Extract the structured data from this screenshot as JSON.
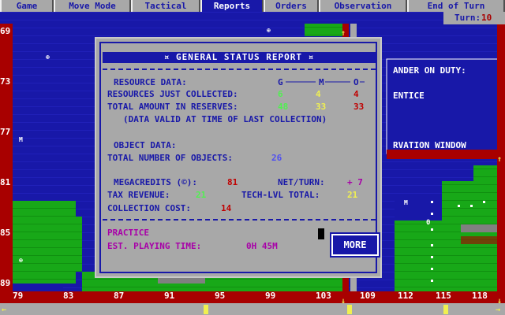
{
  "menu": {
    "items": [
      {
        "label": "Game"
      },
      {
        "label": "Move Mode"
      },
      {
        "label": "Tactical"
      },
      {
        "label": "Reports"
      },
      {
        "label": "Orders"
      },
      {
        "label": "Observation"
      },
      {
        "label": "End of Turn"
      }
    ],
    "active_index": 3
  },
  "turn": {
    "label": "Turn:",
    "value": "10"
  },
  "map": {
    "row_labels": [
      "69",
      "73",
      "77",
      "81",
      "85",
      "89"
    ],
    "col_labels": [
      "79",
      "83",
      "87",
      "91",
      "95",
      "99",
      "103",
      "109",
      "112",
      "115",
      "118"
    ],
    "behind_text_1": "ANDER ON DUTY:",
    "behind_text_2": "ENTICE",
    "behind_text_3": "RVATION WINDOW"
  },
  "report": {
    "title": "¤ GENERAL STATUS REPORT ¤",
    "resource_header": "RESOURCE DATA:",
    "col_g": "G",
    "col_m": "M",
    "col_o": "O",
    "collected_label": "RESOURCES JUST COLLECTED:",
    "collected": {
      "g": "6",
      "m": "4",
      "o": "4"
    },
    "reserves_label": "TOTAL AMOUNT IN RESERVES:",
    "reserves": {
      "g": "48",
      "m": "33",
      "o": "33"
    },
    "validity_note": "(DATA VALID AT TIME OF LAST COLLECTION)",
    "object_header": "OBJECT DATA:",
    "objects_label": "TOTAL NUMBER OF OBJECTS:",
    "objects_value": "26",
    "megacredits_label": "MEGACREDITS (©):",
    "megacredits_value": "81",
    "netturn_label": "NET/TURN:",
    "netturn_value": "+ 7",
    "tax_label": "TAX REVENUE:",
    "tax_value": "21",
    "techlvl_label": "TECH-LVL TOTAL:",
    "techlvl_value": "21",
    "cost_label": "COLLECTION COST:",
    "cost_value": "14",
    "mode": "PRACTICE",
    "playtime_label": "EST. PLAYING TIME:",
    "playtime_value": "0H 45M",
    "more_label": "MORE"
  },
  "colors": {
    "ocean": "#1818a8",
    "land": "#18a818",
    "panel": "#a8a8a8",
    "ruler": "#a80000"
  }
}
